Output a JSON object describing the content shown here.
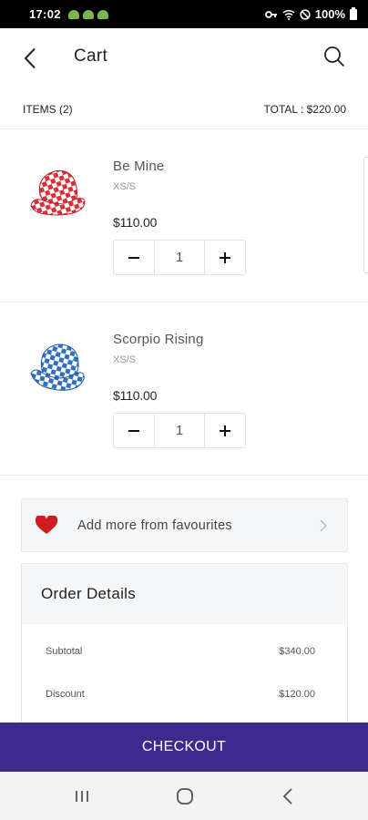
{
  "status_bar": {
    "time": "17:02",
    "battery": "100%"
  },
  "app_bar": {
    "title": "Cart"
  },
  "summary": {
    "items": "ITEMS (2)",
    "total": "TOTAL : $220.00"
  },
  "cart": {
    "items": [
      {
        "name": "Be Mine",
        "size": "XS/S",
        "price": "$110.00",
        "quantity": "1",
        "color": "#d9303a"
      },
      {
        "name": "Scorpio Rising",
        "size": "XS/S",
        "price": "$110.00",
        "quantity": "1",
        "color": "#2f6fc4"
      }
    ]
  },
  "favourites": {
    "label": "Add more from favourites"
  },
  "order_details": {
    "title": "Order Details",
    "rows": [
      {
        "label": "Subtotal",
        "value": "$340.00"
      },
      {
        "label": "Discount",
        "value": "$120.00"
      }
    ]
  },
  "checkout": {
    "label": "CHECKOUT"
  },
  "icons": {
    "back": "chevron-left-icon",
    "search": "search-icon",
    "minus": "minus-icon",
    "plus": "plus-icon",
    "heart": "heart-icon",
    "chevron": "chevron-right-icon"
  },
  "colors": {
    "accent": "#3e2a8c",
    "heart": "#d01c1f"
  }
}
